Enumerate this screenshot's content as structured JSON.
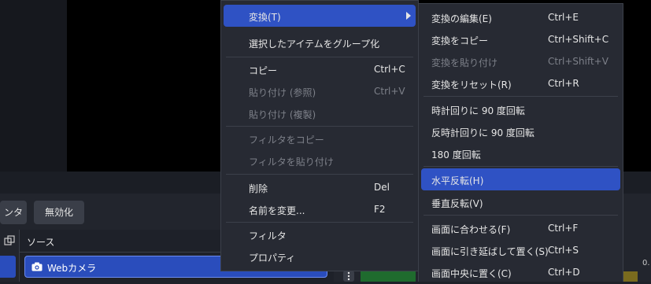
{
  "controls": {
    "filter_partial": "ンタ",
    "disable_label": "無効化"
  },
  "sources": {
    "title": "ソース",
    "items": [
      {
        "label": "Webカメラ",
        "selected": true
      }
    ]
  },
  "mixer": {
    "partial_value": "0."
  },
  "context_menu": {
    "items": [
      {
        "label": "変換(T)",
        "shortcut": "",
        "disabled": false,
        "highlighted": true,
        "submenu": true
      },
      {
        "label": "選択したアイテムをグループ化",
        "shortcut": "",
        "disabled": false
      },
      {
        "label": "コピー",
        "shortcut": "Ctrl+C",
        "disabled": false
      },
      {
        "label": "貼り付け (参照)",
        "shortcut": "Ctrl+V",
        "disabled": true
      },
      {
        "label": "貼り付け (複製)",
        "shortcut": "",
        "disabled": true
      },
      {
        "label": "フィルタをコピー",
        "shortcut": "",
        "disabled": true
      },
      {
        "label": "フィルタを貼り付け",
        "shortcut": "",
        "disabled": true
      },
      {
        "label": "削除",
        "shortcut": "Del",
        "disabled": false
      },
      {
        "label": "名前を変更...",
        "shortcut": "F2",
        "disabled": false
      },
      {
        "label": "フィルタ",
        "shortcut": "",
        "disabled": false
      },
      {
        "label": "プロパティ",
        "shortcut": "",
        "disabled": false
      }
    ]
  },
  "transform_menu": {
    "items": [
      {
        "label": "変換の編集(E)",
        "shortcut": "Ctrl+E",
        "disabled": false
      },
      {
        "label": "変換をコピー",
        "shortcut": "Ctrl+Shift+C",
        "disabled": false
      },
      {
        "label": "変換を貼り付け",
        "shortcut": "Ctrl+Shift+V",
        "disabled": true
      },
      {
        "label": "変換をリセット(R)",
        "shortcut": "Ctrl+R",
        "disabled": false
      },
      {
        "label": "時計回りに 90 度回転",
        "shortcut": "",
        "disabled": false
      },
      {
        "label": "反時計回りに 90 度回転",
        "shortcut": "",
        "disabled": false
      },
      {
        "label": "180 度回転",
        "shortcut": "",
        "disabled": false
      },
      {
        "label": "水平反転(H)",
        "shortcut": "",
        "disabled": false,
        "highlighted": true
      },
      {
        "label": "垂直反転(V)",
        "shortcut": "",
        "disabled": false
      },
      {
        "label": "画面に合わせる(F)",
        "shortcut": "Ctrl+F",
        "disabled": false
      },
      {
        "label": "画面に引き延ばして置く(S)",
        "shortcut": "Ctrl+S",
        "disabled": false
      },
      {
        "label": "画面中央に置く(C)",
        "shortcut": "Ctrl+D",
        "disabled": false
      }
    ]
  },
  "colors": {
    "accent": "#2f52c4",
    "menu_bg": "#272a33",
    "disabled_text": "#7d8089"
  }
}
